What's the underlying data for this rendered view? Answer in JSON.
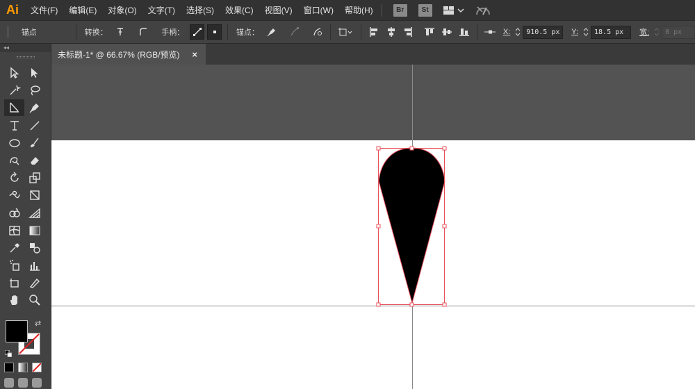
{
  "app": {
    "logo": "Ai"
  },
  "menu": [
    "文件(F)",
    "编辑(E)",
    "对象(O)",
    "文字(T)",
    "选择(S)",
    "效果(C)",
    "视图(V)",
    "窗口(W)",
    "帮助(H)"
  ],
  "app_buttons": {
    "bridge": "Br",
    "stock": "St"
  },
  "control": {
    "panel_label": "锚点",
    "convert_label": "转换：",
    "handles_label": "手柄：",
    "anchors_label": "锚点：",
    "x_label": "X:",
    "x_value": "910.5 px",
    "y_label": "Y:",
    "y_value": "18.5 px",
    "w_label": "宽:",
    "w_value": "0 px"
  },
  "document": {
    "tab_title": "未标题-1* @ 66.67% (RGB/预览)",
    "close_glyph": "×"
  },
  "toolbar": {
    "collapse_glyph": "◂◂",
    "tools": [
      [
        "selection-tool",
        "direct-selection-tool"
      ],
      [
        "magic-wand-tool",
        "lasso-tool"
      ],
      [
        "line-anchor-tool",
        "pen-tool"
      ],
      [
        "type-tool",
        "line-segment-tool"
      ],
      [
        "ellipse-tool",
        "paintbrush-tool"
      ],
      [
        "shaper-tool",
        "eraser-tool"
      ],
      [
        "rotate-tool",
        "scale-tool"
      ],
      [
        "warp-tool",
        "free-transform-tool"
      ],
      [
        "shape-builder-tool",
        "perspective-grid-tool"
      ],
      [
        "mesh-tool",
        "gradient-tool"
      ],
      [
        "eyedropper-tool",
        "blend-tool"
      ],
      [
        "symbol-sprayer-tool",
        "column-graph-tool"
      ],
      [
        "artboard-tool",
        "slice-tool"
      ],
      [
        "hand-tool",
        "zoom-tool"
      ]
    ],
    "active_tool": "line-anchor-tool"
  },
  "colors": {
    "fill": "#000000",
    "stroke": "none",
    "selection": "#e8505b",
    "accent_logo": "#ff9a00"
  }
}
